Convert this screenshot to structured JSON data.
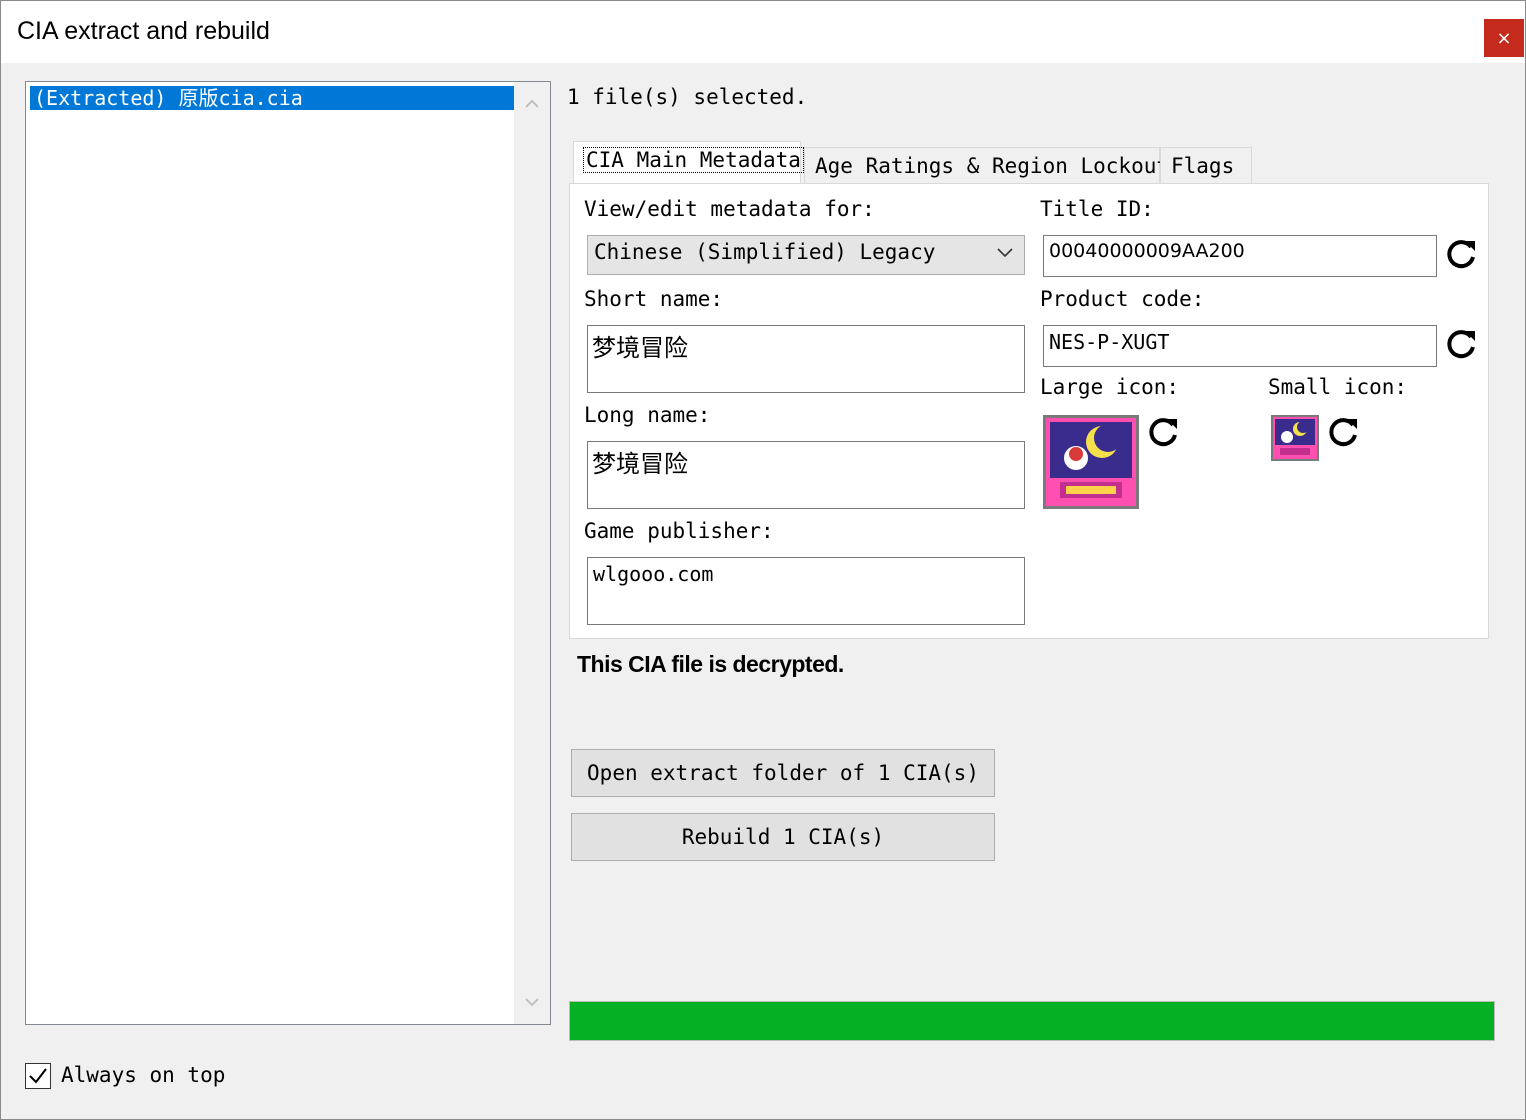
{
  "window": {
    "title": "CIA extract and rebuild",
    "close_label": "×"
  },
  "file_list": {
    "items": [
      {
        "label": "(Extracted) 原版cia.cia",
        "selected": true
      }
    ]
  },
  "selection_status": "1 file(s) selected.",
  "tabs": [
    {
      "label": "CIA Main Metadata",
      "active": true
    },
    {
      "label": "Age Ratings & Region Lockout",
      "active": false
    },
    {
      "label": "Flags",
      "active": false
    }
  ],
  "metadata": {
    "view_edit_label": "View/edit metadata for:",
    "language_selected": "Chinese (Simplified) Legacy",
    "short_name_label": "Short name:",
    "short_name_value": "梦境冒险",
    "long_name_label": "Long name:",
    "long_name_value": "梦境冒险",
    "publisher_label": "Game publisher:",
    "publisher_value": "wlgooo.com",
    "title_id_label": "Title ID:",
    "title_id_value": "00040000009AA200",
    "product_code_label": "Product code:",
    "product_code_value": "NES-P-XUGT",
    "large_icon_label": "Large icon:",
    "small_icon_label": "Small icon:"
  },
  "status_message": "This CIA file is decrypted.",
  "buttons": {
    "open_extract": "Open extract folder of 1 CIA(s)",
    "rebuild": "Rebuild 1 CIA(s)"
  },
  "progress": {
    "percent": 100,
    "color": "#06b025"
  },
  "always_on_top": {
    "label": "Always on top",
    "checked": true
  },
  "colors": {
    "selection": "#0078d7",
    "close": "#c42b1c"
  }
}
